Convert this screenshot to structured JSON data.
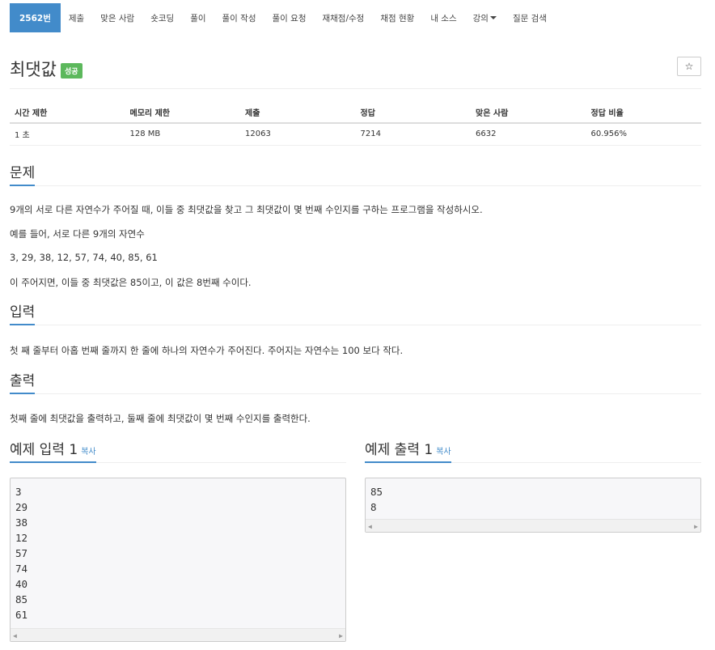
{
  "nav": {
    "items": [
      "2562번",
      "제출",
      "맞은 사람",
      "숏코딩",
      "풀이",
      "풀이 작성",
      "풀이 요청",
      "재채점/수정",
      "채점 현황",
      "내 소스",
      "강의",
      "질문 검색"
    ]
  },
  "title": {
    "text": "최댓값",
    "badge": "성공",
    "star": "☆"
  },
  "info": {
    "headers": [
      "시간 제한",
      "메모리 제한",
      "제출",
      "정답",
      "맞은 사람",
      "정답 비율"
    ],
    "values": [
      "1 초",
      "128 MB",
      "12063",
      "7214",
      "6632",
      "60.956%"
    ]
  },
  "problem": {
    "heading": "문제",
    "paragraphs": [
      "9개의 서로 다른 자연수가 주어질 때, 이들 중 최댓값을 찾고 그 최댓값이 몇 번째 수인지를 구하는 프로그램을 작성하시오.",
      "예를 들어, 서로 다른 9개의 자연수",
      "3, 29, 38, 12, 57, 74, 40, 85, 61",
      "이 주어지면, 이들 중 최댓값은 85이고, 이 값은 8번째 수이다."
    ]
  },
  "input": {
    "heading": "입력",
    "text": "첫 째 줄부터 아홉 번째 줄까지 한 줄에 하나의 자연수가 주어진다. 주어지는 자연수는 100 보다 작다."
  },
  "output": {
    "heading": "출력",
    "text": "첫째 줄에 최댓값을 출력하고, 둘째 줄에 최댓값이 몇 번째 수인지를 출력한다."
  },
  "sample_input": {
    "heading": "예제 입력 1",
    "copy": "복사",
    "lines": [
      "3",
      "29",
      "38",
      "12",
      "57",
      "74",
      "40",
      "85",
      "61"
    ]
  },
  "sample_output": {
    "heading": "예제 출력 1",
    "copy": "복사",
    "lines": [
      "85",
      "8"
    ]
  },
  "scroll": {
    "left": "◀",
    "right": "▶"
  },
  "colors": {
    "accent": "#428bca",
    "success": "#5cb85c"
  }
}
